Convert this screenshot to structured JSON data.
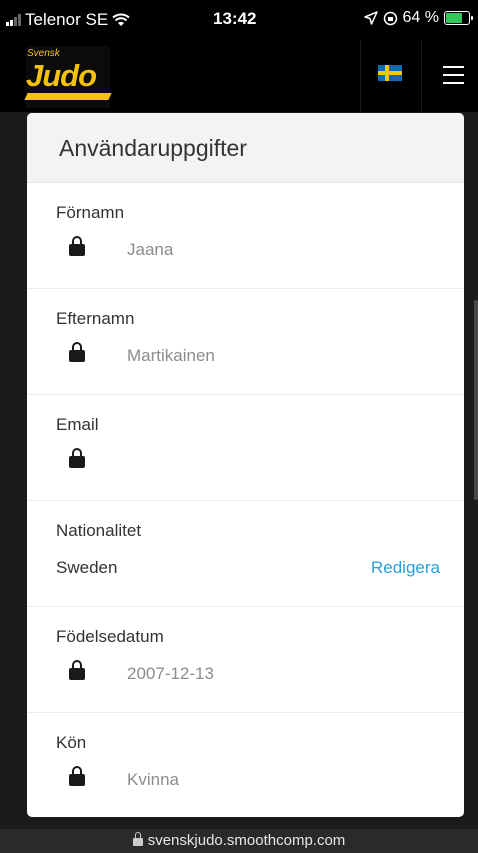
{
  "status_bar": {
    "carrier": "Telenor SE",
    "time": "13:42",
    "battery": "64 %"
  },
  "header": {
    "logo_small": "Svensk",
    "logo_main": "Judo",
    "flag_icon": "sweden-flag-icon",
    "menu_icon": "hamburger-menu-icon"
  },
  "card": {
    "title": "Användaruppgifter",
    "fields": [
      {
        "label": "Förnamn",
        "value": "Jaana",
        "locked": true
      },
      {
        "label": "Efternamn",
        "value": "Martikainen",
        "locked": true
      },
      {
        "label": "Email",
        "value": "",
        "locked": true
      },
      {
        "label": "Nationalitet",
        "value": "Sweden",
        "locked": false,
        "action": "Redigera"
      },
      {
        "label": "Födelsedatum",
        "value": "2007-12-13",
        "locked": true
      },
      {
        "label": "Kön",
        "value": "Kvinna",
        "locked": true
      }
    ]
  },
  "url_bar": {
    "url": "svenskjudo.smoothcomp.com"
  },
  "colors": {
    "brand_yellow": "#f4c20d",
    "link_blue": "#2a9fd6",
    "background": "#1b1b1b"
  }
}
